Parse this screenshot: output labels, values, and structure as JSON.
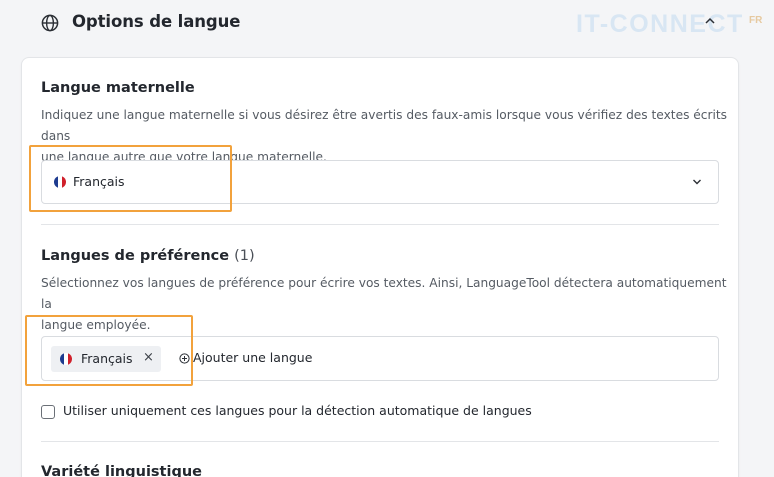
{
  "header": {
    "title": "Options de langue",
    "watermark": "IT-CONNECT",
    "watermark_suffix": "FR"
  },
  "native_language": {
    "heading": "Langue maternelle",
    "description_line1": "Indiquez une langue maternelle si vous désirez être avertis des faux-amis lorsque vous vérifiez des textes écrits dans",
    "description_line2": "une langue autre que votre langue maternelle.",
    "selected": "Français",
    "flag_colors": [
      "#1d3b8f",
      "#ffffff",
      "#d0202b"
    ]
  },
  "preferred_languages": {
    "heading": "Langues de préférence",
    "count": "(1)",
    "description_line1": "Sélectionnez vos langues de préférence pour écrire vos textes. Ainsi, LanguageTool détectera automatiquement la",
    "description_line2": "langue employée.",
    "chips": [
      {
        "label": "Français",
        "remove_glyph": "×"
      }
    ],
    "add_label": "Ajouter une langue"
  },
  "detection_checkbox": {
    "label": "Utiliser uniquement ces langues pour la détection automatique de langues",
    "checked": false
  },
  "variety": {
    "heading": "Variété linguistique"
  },
  "colors": {
    "highlight": "#f2a23c",
    "card_background": "#ffffff",
    "page_background": "#f4f5f7"
  }
}
